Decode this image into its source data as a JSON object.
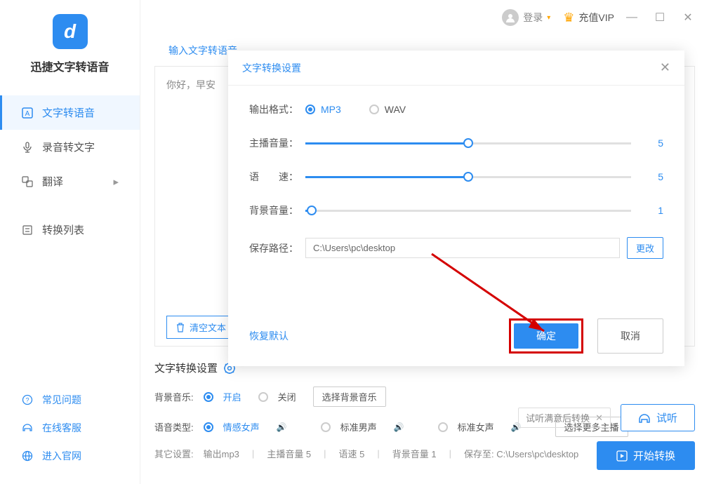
{
  "app": {
    "name": "迅捷文字转语音"
  },
  "titlebar": {
    "login": "登录",
    "vip": "充值VIP"
  },
  "sidebar": {
    "items": [
      {
        "label": "文字转语音"
      },
      {
        "label": "录音转文字"
      },
      {
        "label": "翻译"
      },
      {
        "label": "转换列表"
      }
    ],
    "bottom": [
      {
        "label": "常见问题"
      },
      {
        "label": "在线客服"
      },
      {
        "label": "进入官网"
      }
    ]
  },
  "tabs": {
    "input": "输入文字转语音"
  },
  "editor": {
    "placeholder": "你好，早安",
    "clear": "清空文本"
  },
  "settingsBar": {
    "title": "文字转换设置",
    "bgm": {
      "label": "背景音乐:",
      "on": "开启",
      "off": "关闭",
      "select": "选择背景音乐"
    },
    "voice": {
      "label": "语音类型:",
      "opt1": "情感女声",
      "opt2": "标准男声",
      "opt3": "标准女声",
      "more": "选择更多主播"
    },
    "other": {
      "label": "其它设置:",
      "format": "输出mp3",
      "vol": "主播音量 5",
      "speed": "语速 5",
      "bgmvol": "背景音量 1",
      "path": "保存至: C:\\Users\\pc\\desktop"
    }
  },
  "actions": {
    "hint": "试听满意后转换",
    "preview": "试听",
    "convert": "开始转换"
  },
  "dialog": {
    "title": "文字转换设置",
    "format": {
      "label": "输出格式：",
      "mp3": "MP3",
      "wav": "WAV"
    },
    "volume": {
      "label": "主播音量：",
      "value": "5",
      "percent": 50
    },
    "speed": {
      "label": "语　　速：",
      "value": "5",
      "percent": 50
    },
    "bgm": {
      "label": "背景音量：",
      "value": "1",
      "percent": 2
    },
    "path": {
      "label": "保存路径：",
      "value": "C:\\Users\\pc\\desktop",
      "change": "更改"
    },
    "restore": "恢复默认",
    "confirm": "确定",
    "cancel": "取消"
  }
}
